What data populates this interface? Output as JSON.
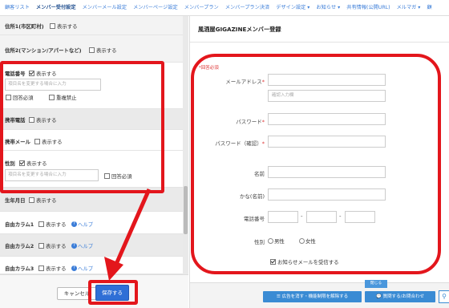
{
  "topnav": {
    "items": [
      {
        "label": "顧客リスト",
        "active": false
      },
      {
        "label": "メンバー受付設定",
        "active": true
      },
      {
        "label": "メンバーメール設定",
        "active": false
      },
      {
        "label": "メンバーページ設定",
        "active": false
      },
      {
        "label": "メンバープラン",
        "active": false
      },
      {
        "label": "メンバープラン決済",
        "active": false
      },
      {
        "label": "デザイン設定 ▾",
        "active": false
      },
      {
        "label": "お知らせ ▾",
        "active": false
      },
      {
        "label": "共有情報(公開URL)",
        "active": false
      },
      {
        "label": "メルマガ ▾",
        "active": false
      },
      {
        "label": "顧",
        "active": false
      }
    ]
  },
  "left": {
    "address1": {
      "label": "住所1(市区町村)",
      "show": "表示する"
    },
    "address2": {
      "label": "住所2(マンション/アパートなど)",
      "show": "表示する"
    },
    "phone": {
      "label": "電話番号",
      "show": "表示する",
      "placeholder": "項目名を変更する場合に入力",
      "required": "回答必須",
      "no_dup": "重複禁止"
    },
    "mobile": {
      "label": "携帯電話",
      "show": "表示する"
    },
    "mobile_mail": {
      "label": "携帯メール",
      "show": "表示する"
    },
    "gender": {
      "label": "性別",
      "show": "表示する",
      "placeholder": "項目名を変更する場合に入力",
      "required": "回答必須"
    },
    "birthday": {
      "label": "生年月日",
      "show": "表示する"
    },
    "free1": {
      "label": "自由カラム1",
      "show": "表示する",
      "help": "ヘルプ"
    },
    "free2": {
      "label": "自由カラム2",
      "show": "表示する",
      "help": "ヘルプ"
    },
    "free3": {
      "label": "自由カラム3",
      "show": "表示する",
      "help": "ヘルプ"
    }
  },
  "bottom": {
    "cancel": "キャンセル",
    "save": "保存する"
  },
  "preview": {
    "title": "風酒屋GIGAZINEメンバー登録",
    "required_note": "*回答必須",
    "email_label": "メールアドレス",
    "email_confirm_placeholder": "確認入力欄",
    "password_label": "パスワード",
    "password_confirm_label": "パスワード（確認）",
    "name_label": "名前",
    "kana_label": "かな(名前)",
    "phone_label": "電話番号",
    "gender_label": "性別",
    "male": "男性",
    "female": "女性",
    "newsletter": "お知らせメールを受信する",
    "required_mark": "*",
    "dash": "-",
    "ad_button": "広告を消す・機能制限を解除する",
    "inquiry_button": "質問する/お問合わせ",
    "popup_label": "閉じる"
  },
  "icons": {
    "help": "help-circle-icon",
    "search": "search-icon",
    "list": "list-icon",
    "chat": "chat-icon"
  },
  "colors": {
    "link": "#3b7dd8",
    "save": "#2f6fd6",
    "annotation": "#e3161c"
  }
}
